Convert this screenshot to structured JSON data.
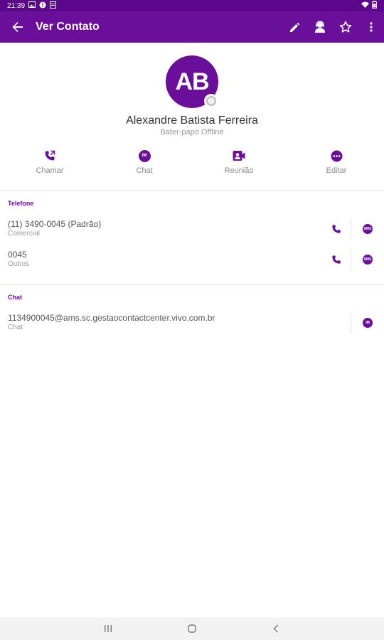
{
  "status_bar": {
    "time": "21:39"
  },
  "app_bar": {
    "title": "Ver Contato",
    "back_icon": "arrow-left-icon",
    "actions": [
      "pencil-icon",
      "agent-icon",
      "star-icon",
      "more-vert-icon"
    ]
  },
  "profile": {
    "initials": "AB",
    "name": "Alexandre Batista Ferreira",
    "status": "Bater-papo Offline"
  },
  "quick_actions": [
    {
      "label": "Chamar",
      "icon": "phone-transfer-icon"
    },
    {
      "label": "Chat",
      "icon": "im-chat-icon"
    },
    {
      "label": "Reunião",
      "icon": "meeting-icon"
    },
    {
      "label": "Editar",
      "icon": "more-horiz-icon"
    }
  ],
  "sections": {
    "phone": {
      "title": "Telefone",
      "items": [
        {
          "value": "(11) 3490-0045 (Padrão)",
          "type": "Comercial"
        },
        {
          "value": "0045",
          "type": "Outros"
        }
      ]
    },
    "chat": {
      "title": "Chat",
      "items": [
        {
          "value": "1134900045@ams.sc.gestaocontactcenter.vivo.com.br",
          "type": "Chat"
        }
      ]
    }
  },
  "chat_badge_text": "IM",
  "sms_badge_text": "SMS",
  "colors": {
    "primary": "#6a0f9a",
    "status_bar": "#5c068c"
  }
}
